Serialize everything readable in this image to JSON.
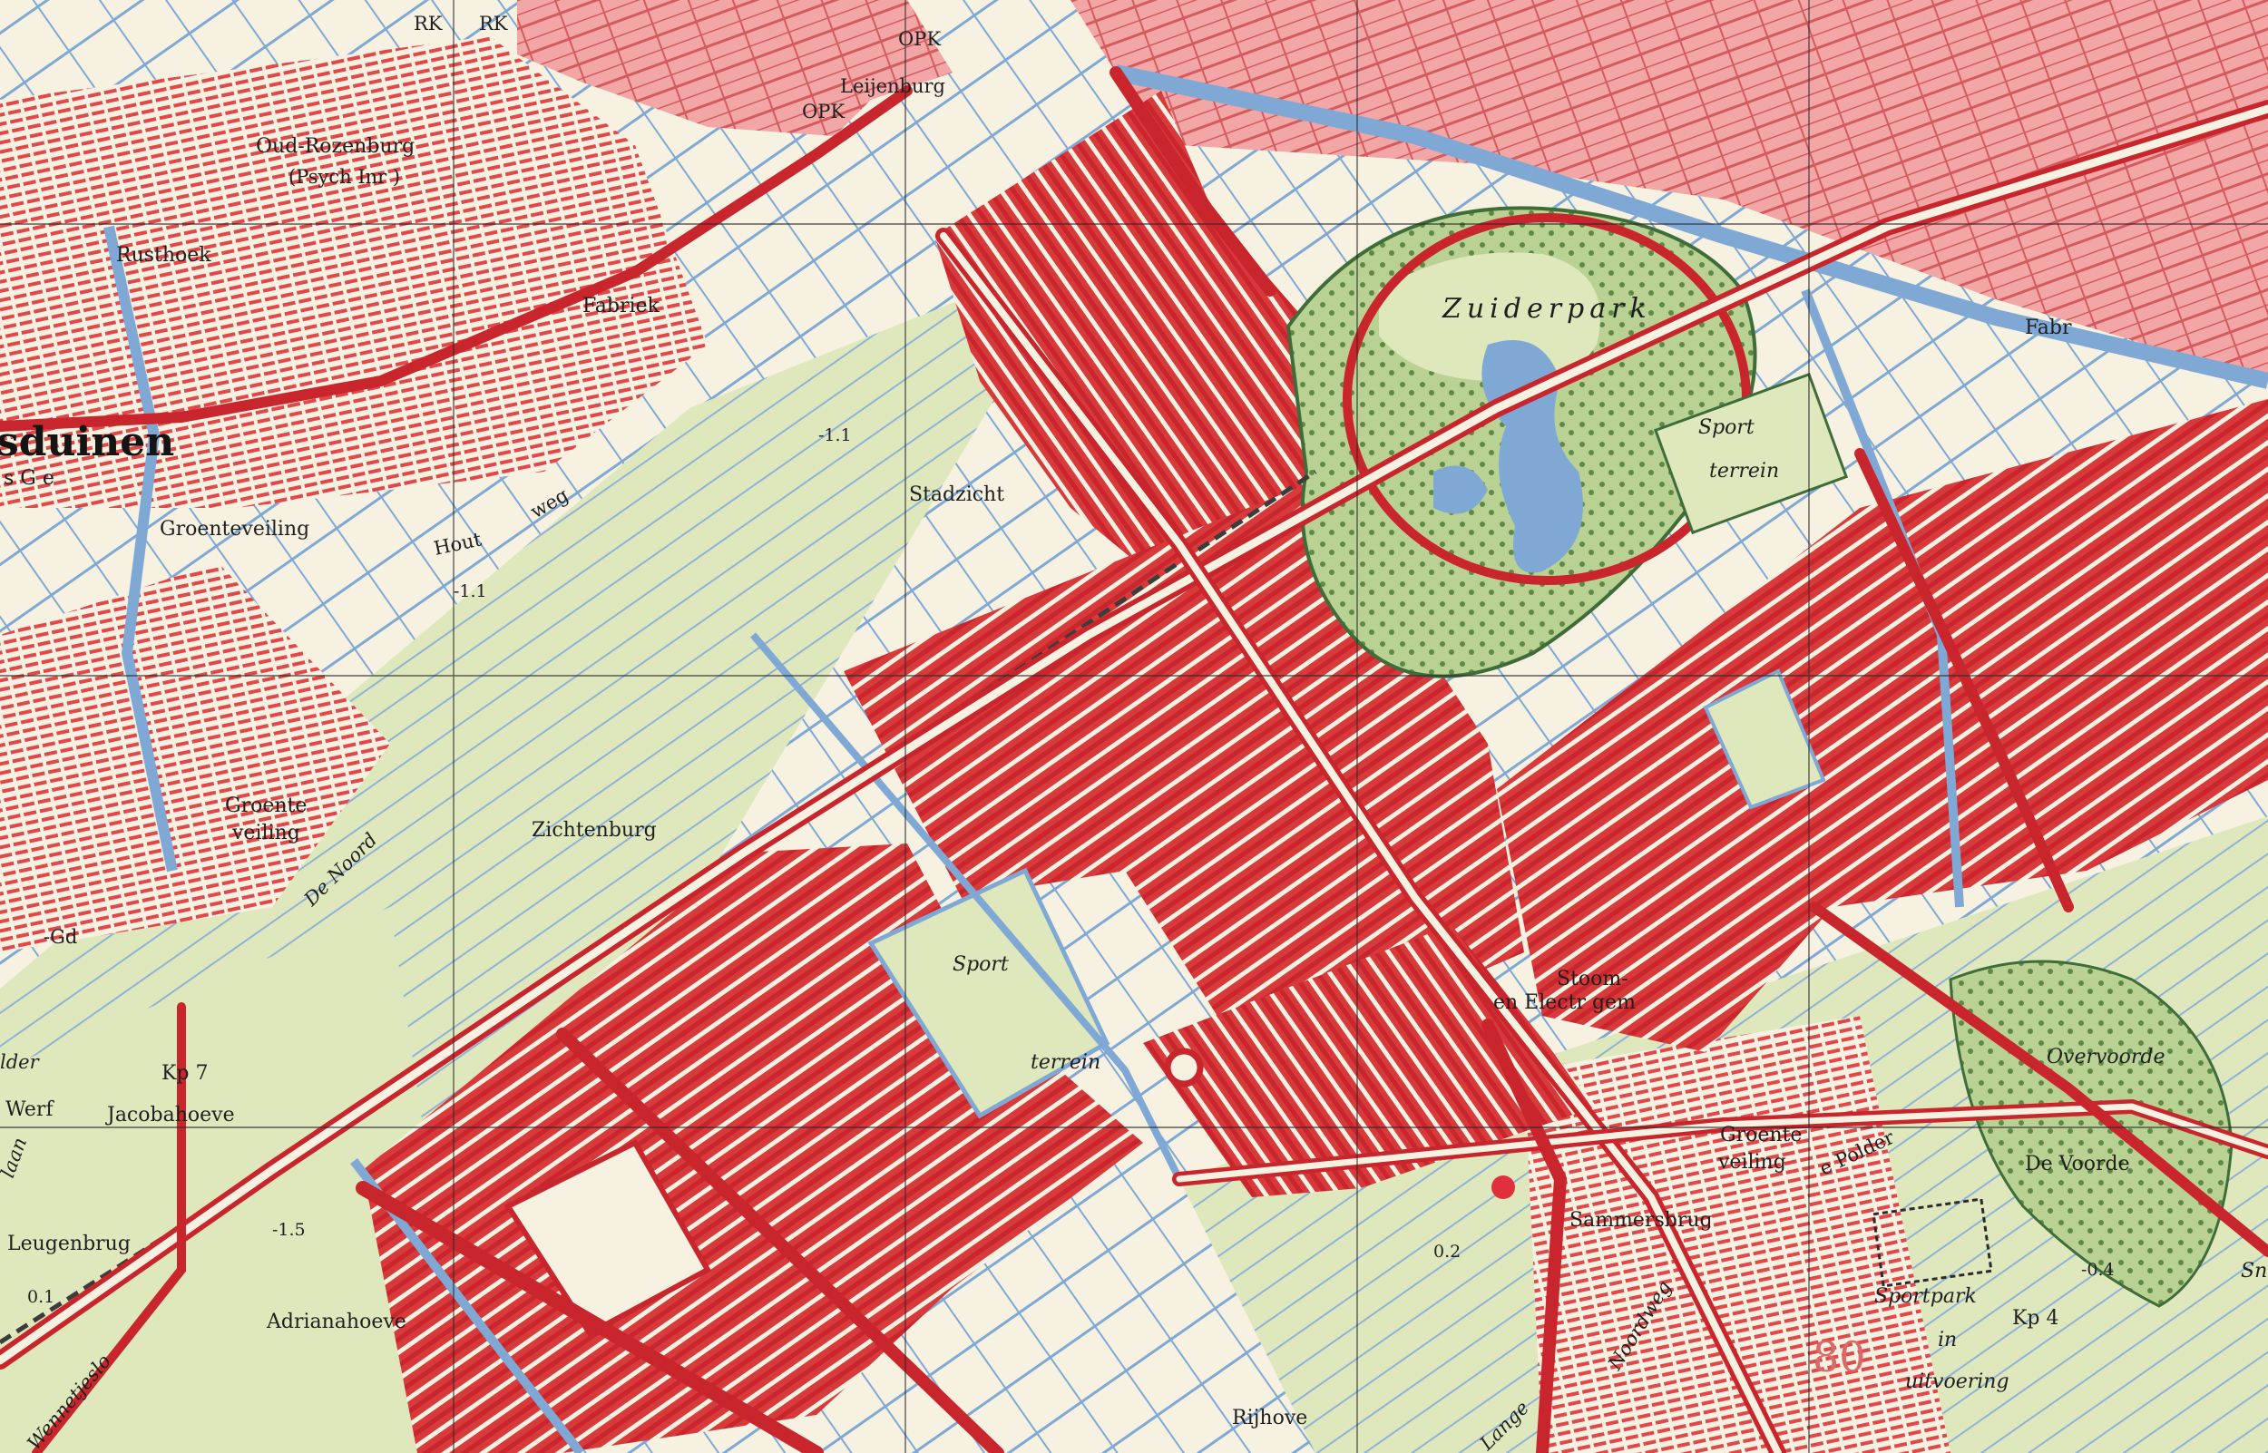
{
  "map": {
    "colors": {
      "background": "#f6f1e1",
      "urban_area": "#f2a6a6",
      "building_block": "#d8393b",
      "street_fill": "#f6f1e1",
      "street_casing": "#c8262c",
      "water": "#7fa9d4",
      "meadow": "#dfe8bd",
      "park": "#b9d192",
      "grid_line": "#2b2b2b"
    },
    "labels": {
      "loosduinen": "sduinen",
      "loosduinen_sub": "s G e",
      "oud_rozenburg": "Oud-Rozenburg",
      "psych_inr": "(Psych Inr )",
      "rusthoek": "Rusthoek",
      "fabriek": "Fabriek",
      "leijenburg": "Leijenburg",
      "rk1": "RK",
      "rk2": "RK",
      "opk1": "OPK",
      "opk2": "OPK",
      "stadzicht": "Stadzicht",
      "groenteveiling_1": "Groenteveiling",
      "hout": "Hout",
      "weg": "weg",
      "groente_a": "Groente",
      "veiling_a": "veiling",
      "de_noord": "De Noord",
      "zichtenburg": "Zichtenburg",
      "gd": "-Gd",
      "kp7": "Kp 7",
      "jacobahoeve": "Jacobahoeve",
      "werf": "Werf",
      "leugenbrug": "Leugenbrug",
      "adrianahoeve": "Adrianahoeve",
      "zuiderpark": "Zuiderpark",
      "sport_a": "Sport",
      "terrein_a": "terrein",
      "sport_b": "Sport",
      "terrein_b": "terrein",
      "fabr": "Fabr",
      "stoom": "Stoom-",
      "electr": "en Electr gem",
      "groente_b": "Groente",
      "veiling_b": "veiling",
      "polder_weg": "e Polder",
      "sammersbrug": "Sammersbrug",
      "noordweg": "Noordweg",
      "lange": "Lange",
      "rijhove": "Rijhove",
      "de_voorde": "De Voorde",
      "overvoorde": "Overvoorde",
      "sportpark": "Sportpark",
      "in": "in",
      "uitvoering": "uitvoering",
      "kp4": "Kp 4",
      "sheet_number": "80",
      "wennetjeslaan": "Wennetjeslo",
      "sn_frag": "Sn",
      "der": "lder",
      "vlaan": "laan"
    },
    "elevations": {
      "e_1_1a": "-1.1",
      "e_1_1b": "-1.1",
      "e_1_5": "-1.5",
      "e_0_1": "0.1",
      "e_0_2": "0.2",
      "e_0_4": "-0.4"
    }
  }
}
